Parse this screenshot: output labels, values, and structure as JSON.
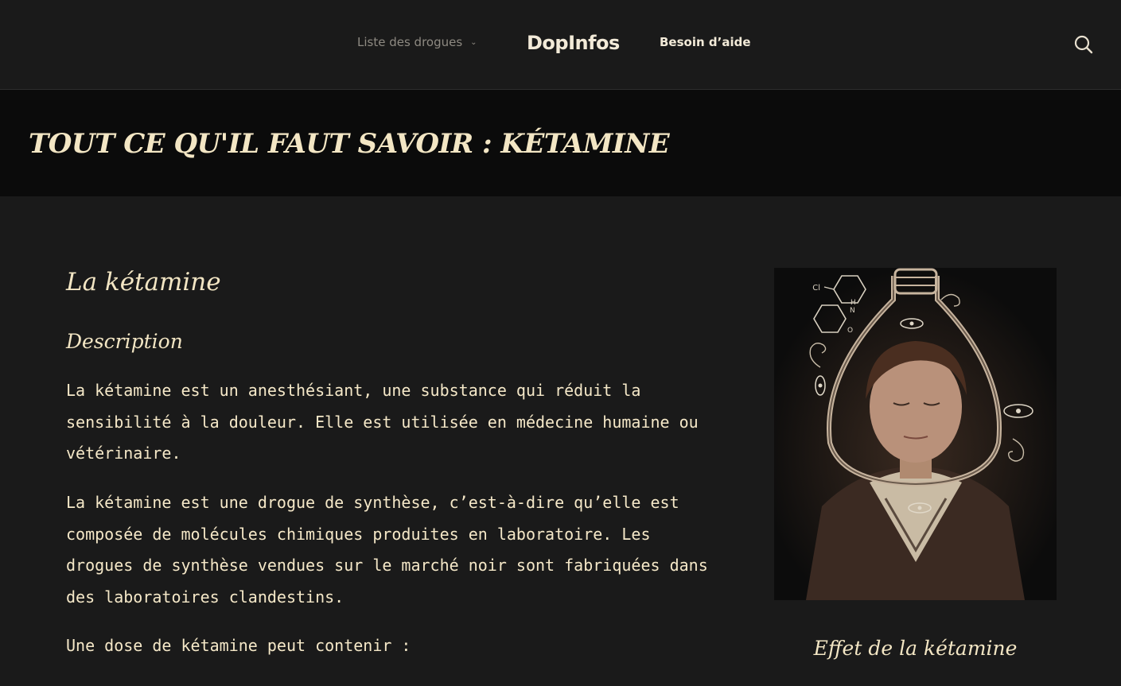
{
  "header": {
    "nav_drugs": "Liste des drogues",
    "brand": "DopInfos",
    "nav_help": "Besoin d’aide"
  },
  "hero": {
    "title": "TOUT CE QU'IL FAUT SAVOIR : KÉTAMINE"
  },
  "article": {
    "heading": "La kétamine",
    "subheading": "Description",
    "paragraphs": [
      "La kétamine est un anesthésiant, une substance qui réduit la sensibilité à la douleur. Elle est utilisée en médecine humaine ou vétérinaire.",
      "La kétamine est une drogue de synthèse, c’est-à-dire qu’elle est composée de molécules chimiques produites en laboratoire. Les drogues de synthèse vendues sur le marché noir sont fabriquées dans des laboratoires clandestins.",
      "Une dose de kétamine peut contenir :"
    ],
    "figure_caption": "Effet de la kétamine"
  },
  "icons": {
    "search": "search-icon",
    "dropdown": "chevron-down-icon"
  },
  "colors": {
    "background": "#1a1a1a",
    "hero_background": "#0b0b0b",
    "text_cream": "#f5e8c8",
    "nav_muted": "#8e8a82"
  }
}
